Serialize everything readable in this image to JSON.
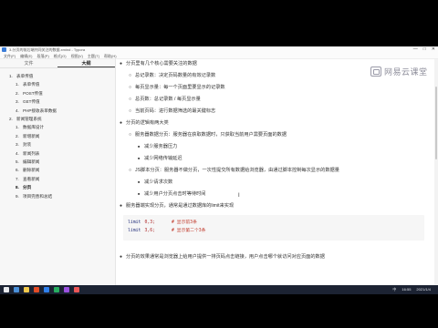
{
  "window": {
    "title": "3-分页的前后端共同关注的数据.xmind - Typora",
    "controls": [
      "—",
      "□",
      "✕"
    ]
  },
  "menubar": [
    "文件(F)",
    "编辑(E)",
    "段落(P)",
    "格式(O)",
    "视图(V)",
    "主题(T)",
    "帮助(H)"
  ],
  "sidebar": {
    "tabs": [
      "文件",
      "大纲"
    ],
    "active_tab": 1,
    "items": [
      {
        "num": "1.",
        "label": "表单传值",
        "level": 1,
        "bold": false
      },
      {
        "num": "1.",
        "label": "表单传值",
        "level": 2,
        "bold": false
      },
      {
        "num": "2.",
        "label": "POST传值",
        "level": 2,
        "bold": false
      },
      {
        "num": "3.",
        "label": "GET传值",
        "level": 2,
        "bold": false
      },
      {
        "num": "4.",
        "label": "PHP接收表单数据",
        "level": 2,
        "bold": false
      },
      {
        "num": "2.",
        "label": "新闻管理系统",
        "level": 1,
        "bold": false
      },
      {
        "num": "1.",
        "label": "数据库设计",
        "level": 2,
        "bold": false
      },
      {
        "num": "2.",
        "label": "新增新闻",
        "level": 2,
        "bold": false
      },
      {
        "num": "3.",
        "label": "封装",
        "level": 2,
        "bold": false
      },
      {
        "num": "4.",
        "label": "新闻列表",
        "level": 2,
        "bold": false
      },
      {
        "num": "5.",
        "label": "编辑新闻",
        "level": 2,
        "bold": false
      },
      {
        "num": "6.",
        "label": "删除新闻",
        "level": 2,
        "bold": false
      },
      {
        "num": "7.",
        "label": "查看新闻",
        "level": 2,
        "bold": false
      },
      {
        "num": "8.",
        "label": "分页",
        "level": 2,
        "bold": true
      },
      {
        "num": "9.",
        "label": "项目完善和总结",
        "level": 2,
        "bold": false
      }
    ]
  },
  "watermark": {
    "text": "网易云课堂",
    "icon": "netease-cloud-classroom-logo"
  },
  "content": {
    "lines": [
      {
        "text": "分页里有几个核心需要关注的数据",
        "level": 1,
        "bullet": "●"
      },
      {
        "text": "总记录数：决定页码数量的有效记录数",
        "level": 2,
        "bullet": "○"
      },
      {
        "text": "每页显示量：每一个页面里要显示的记录数",
        "level": 2,
        "bullet": "○"
      },
      {
        "text": "总页数：总记录数 / 每页显示量",
        "level": 2,
        "bullet": "○"
      },
      {
        "text": "当前页码：进行数据筛选的最关键标志",
        "level": 2,
        "bullet": "○"
      },
      {
        "text": "分页的逻辑有两大类",
        "level": 1,
        "bullet": "●"
      },
      {
        "text": "服务器数据分页：服务器在获取数据时，只获取当前用户需要页面的数据",
        "level": 2,
        "bullet": "○"
      },
      {
        "text": "减少服务器压力",
        "level": 3,
        "bullet": "■"
      },
      {
        "text": "减少网络传输延迟",
        "level": 3,
        "bullet": "■"
      },
      {
        "text": "JS脚本分页：服务器不做分页，一次性提交所有数据给浏览器，由通过脚本控制每次显示的数据量",
        "level": 2,
        "bullet": "○"
      },
      {
        "text": "减少请求次数",
        "level": 3,
        "bullet": "■"
      },
      {
        "text": "减少用户分页点击时等待时间",
        "level": 3,
        "bullet": "■"
      },
      {
        "text": "服务器端实现分页，通常是通过数据库的limit来实现",
        "level": 1,
        "bullet": "●"
      },
      {
        "text": "分页的效果通常是浏览器上给用户提供一排页码点击链接，用户点击哪个就访问对应页面的数据",
        "level": 1,
        "bullet": "●"
      }
    ],
    "code": [
      {
        "kw": "limit",
        "args": "0,3;",
        "comment": "# 显示前3条"
      },
      {
        "kw": "limit",
        "args": "3,6;",
        "comment": "# 显示第二个3条"
      }
    ],
    "caret": "I"
  },
  "taskbar": {
    "clock": "16:55",
    "date": "2021/1/4",
    "lang": "中",
    "icon_colors": [
      "#e8eaed",
      "#4a90d9",
      "#f2c94c",
      "#e34c26",
      "#2f80ed",
      "#27ae60",
      "#9b51e0",
      "#eb5757"
    ]
  }
}
